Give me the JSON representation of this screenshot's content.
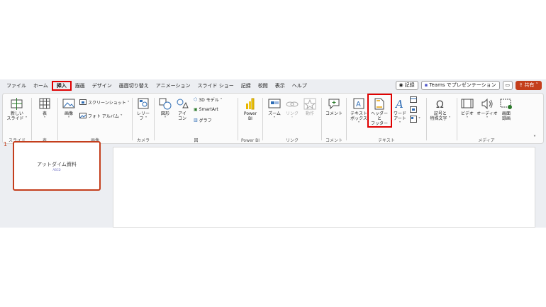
{
  "menu": {
    "tabs": [
      "ファイル",
      "ホーム",
      "挿入",
      "描画",
      "デザイン",
      "画面切り替え",
      "アニメーション",
      "スライド ショー",
      "記録",
      "校閲",
      "表示",
      "ヘルプ"
    ],
    "active_tab": "挿入",
    "record_label": "記録",
    "teams_label": "Teams でプレゼンテーション",
    "share_label": "共有"
  },
  "ribbon": {
    "groups": {
      "slides": "スライド",
      "tables": "表",
      "images": "画像",
      "camera": "カメラ",
      "illustrations": "図",
      "powerbi": "Power BI",
      "links": "リンク",
      "comments": "コメント",
      "text": "テキスト",
      "media": "メディア"
    },
    "buttons": {
      "new_slide_1": "新しい",
      "new_slide_2": "スライド ˅",
      "table_1": "表",
      "table_2": "˅",
      "image_1": "画像",
      "image_2": "˅",
      "screenshot": "スクリーンショット ˅",
      "photo_album": "フォト アルバム ˅",
      "cameo_1": "レリー",
      "cameo_2": "フ ˅",
      "shapes_1": "図形",
      "shapes_2": "˅",
      "icons_1": "アイ",
      "icons_2": "コン",
      "model3d": "3D モデル ˅",
      "smartart": "SmartArt",
      "chart": "グラフ",
      "powerbi_1": "Power",
      "powerbi_2": "BI",
      "zoom_1": "ズーム",
      "zoom_2": "˅",
      "link_1": "リンク",
      "link_2": "˅",
      "action": "動作",
      "comment": "コメント",
      "textbox_1": "テキスト",
      "textbox_2": "ボックス ˅",
      "header_footer_1": "ヘッダーと",
      "header_footer_2": "フッター",
      "wordart_1": "ワード",
      "wordart_2": "アート ˅",
      "symbols_1": "記号と",
      "symbols_2": "特殊文字 ˅",
      "video_1": "ビデオ",
      "video_2": "˅",
      "audio_1": "オーディオ",
      "audio_2": "˅",
      "screen_rec_1": "画面",
      "screen_rec_2": "録画"
    }
  },
  "slides": [
    {
      "number": "1",
      "title": "アットダイム資料",
      "subtitle": "ABCD"
    }
  ],
  "colors": {
    "accent": "#c43e1c",
    "highlight": "#e00000",
    "ribbon_bg": "#fbfbfb",
    "app_bg": "#eceef2"
  }
}
